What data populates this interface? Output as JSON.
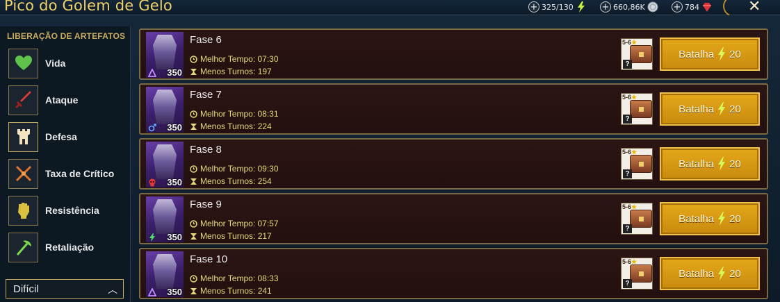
{
  "header": {
    "title": "Pico do Golem de Gelo",
    "resources": [
      {
        "value": "325/130",
        "icon": "energy-bolt-icon"
      },
      {
        "value": "660,86K",
        "icon": "silver-coin-icon"
      },
      {
        "value": "784",
        "icon": "gem-icon"
      }
    ],
    "close_label": "✕"
  },
  "sidebar": {
    "heading": "LIBERAÇÃO DE ARTEFATOS",
    "items": [
      {
        "label": "Vida",
        "icon": "heart-icon",
        "color": "#5fc24a"
      },
      {
        "label": "Ataque",
        "icon": "sword-icon",
        "color": "#d63a3a"
      },
      {
        "label": "Defesa",
        "icon": "tower-icon",
        "color": "#e9c07a"
      },
      {
        "label": "Taxa de Crítico",
        "icon": "crossed-swords-icon",
        "color": "#e0742a"
      },
      {
        "label": "Resistência",
        "icon": "fist-icon",
        "color": "#d9c040"
      },
      {
        "label": "Retaliação",
        "icon": "axe-icon",
        "color": "#7ed84e"
      }
    ],
    "difficulty": {
      "selected": "Difícil"
    }
  },
  "stages": [
    {
      "name": "Fase 6",
      "best_time_label": "Melhor Tempo: 07:30",
      "fewest_turns_label": "Menos Turnos: 197",
      "power": "350",
      "affinity": "magic",
      "stars_label": "5-6",
      "battle_label": "Batalha",
      "energy_cost": "20"
    },
    {
      "name": "Fase 7",
      "best_time_label": "Melhor Tempo: 08:31",
      "fewest_turns_label": "Menos Turnos: 224",
      "power": "350",
      "affinity": "force",
      "stars_label": "5-6",
      "battle_label": "Batalha",
      "energy_cost": "20"
    },
    {
      "name": "Fase 8",
      "best_time_label": "Melhor Tempo: 09:30",
      "fewest_turns_label": "Menos Turnos: 254",
      "power": "350",
      "affinity": "void",
      "stars_label": "5-6",
      "battle_label": "Batalha",
      "energy_cost": "20"
    },
    {
      "name": "Fase 9",
      "best_time_label": "Melhor Tempo: 07:57",
      "fewest_turns_label": "Menos Turnos: 217",
      "power": "350",
      "affinity": "spirit",
      "stars_label": "5-6",
      "battle_label": "Batalha",
      "energy_cost": "20"
    },
    {
      "name": "Fase 10",
      "best_time_label": "Melhor Tempo: 08:33",
      "fewest_turns_label": "Menos Turnos: 241",
      "power": "350",
      "affinity": "magic",
      "stars_label": "5-6",
      "battle_label": "Batalha",
      "energy_cost": "20"
    }
  ],
  "colors": {
    "title_gold": "#f0d26a",
    "stat_yellow": "#e7d97a",
    "button_gold": "#e4a819",
    "row_bg": "#2b1414"
  }
}
